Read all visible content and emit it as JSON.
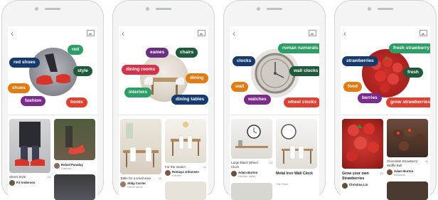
{
  "phones": [
    {
      "topic": "sneakers",
      "tags": [
        {
          "label": "red",
          "color": "#2c9e66"
        },
        {
          "label": "red shoes",
          "color": "#163a6e"
        },
        {
          "label": "style",
          "color": "#1f5a3c"
        },
        {
          "label": "shoes",
          "color": "#e37b13"
        },
        {
          "label": "fashion",
          "color": "#7a2b8c"
        },
        {
          "label": "boots",
          "color": "#e0402f"
        }
      ],
      "pins": [
        {
          "caption": "Street Style",
          "count": "∙ 24",
          "user": "PJ Anderson",
          "board": ""
        },
        {
          "caption": "",
          "count": "",
          "user": "Rafael Paraday",
          "board": "Fashion"
        }
      ]
    },
    {
      "topic": "interior",
      "tags": [
        {
          "label": "eames",
          "color": "#6b2f82"
        },
        {
          "label": "chairs",
          "color": "#1f5a3c"
        },
        {
          "label": "dining rooms",
          "color": "#d5334b"
        },
        {
          "label": "dining",
          "color": "#e37b13"
        },
        {
          "label": "interiors",
          "color": "#2c9e66"
        },
        {
          "label": "dining tables",
          "color": "#163a6e"
        }
      ],
      "pins": [
        {
          "caption": "Table for a small area",
          "count": "∙ 42",
          "user": "Abby Carrier",
          "board": "Home Ideas"
        },
        {
          "caption": "For the studio!",
          "count": "∙ 24",
          "user": "Romaya Johansen",
          "board": "Kitchen"
        }
      ]
    },
    {
      "topic": "clocks",
      "tags": [
        {
          "label": "roman numerals",
          "color": "#2c9e66"
        },
        {
          "label": "clocks",
          "color": "#163a6e"
        },
        {
          "label": "wall clocks",
          "color": "#1f5a3c"
        },
        {
          "label": "wall",
          "color": "#e37b13"
        },
        {
          "label": "watches",
          "color": "#7a2b8c"
        },
        {
          "label": "wheel clocks",
          "color": "#e0402f"
        }
      ],
      "pins": [
        {
          "caption": "Large Black Wheel Clock",
          "count": "∙ 24",
          "user": "Adam Burton",
          "board": "Kitchen Ideas"
        },
        {
          "caption": "Metal Iron Wall Clock",
          "count": "",
          "user": "",
          "board": "The Store"
        }
      ]
    },
    {
      "topic": "strawberries",
      "tags": [
        {
          "label": "fresh strawberry",
          "color": "#2c9e66"
        },
        {
          "label": "strawberries",
          "color": "#163a6e"
        },
        {
          "label": "fresh",
          "color": "#1f5a3c"
        },
        {
          "label": "food",
          "color": "#e37b13"
        },
        {
          "label": "berries",
          "color": "#7a2b8c"
        },
        {
          "label": "grow strawberries",
          "color": "#e0402f"
        }
      ],
      "pins": [
        {
          "caption": "Grow your own Strawberries",
          "count": "∙ 24",
          "user": "Christina Lin",
          "board": ""
        },
        {
          "caption": "Chocolate Strawberry Waffle Ball",
          "count": "∙ 32",
          "user": "Adam Burton",
          "board": "Desserts"
        }
      ]
    }
  ]
}
